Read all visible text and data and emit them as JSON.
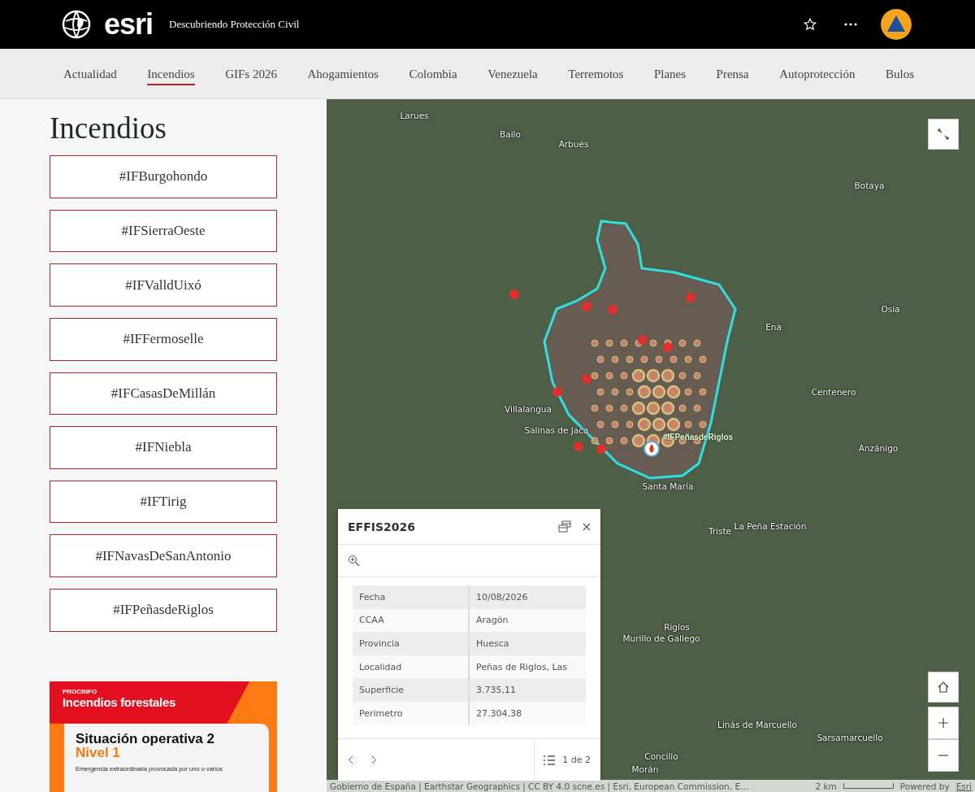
{
  "header": {
    "brand": "esri",
    "title": "Descubriendo Protección Civil"
  },
  "nav": [
    {
      "label": "Actualidad",
      "selected": false
    },
    {
      "label": "Incendios",
      "selected": true
    },
    {
      "label": "GIFs 2026",
      "selected": false
    },
    {
      "label": "Ahogamientos",
      "selected": false
    },
    {
      "label": "Colombia",
      "selected": false
    },
    {
      "label": "Venezuela",
      "selected": false
    },
    {
      "label": "Terremotos",
      "selected": false
    },
    {
      "label": "Planes",
      "selected": false
    },
    {
      "label": "Prensa",
      "selected": false
    },
    {
      "label": "Autoprotección",
      "selected": false
    },
    {
      "label": "Bulos",
      "selected": false
    }
  ],
  "sidebar": {
    "heading": "Incendios",
    "links": [
      "#IFBurgohondo",
      "#IFSierraOeste",
      "#IFValldUixó",
      "#IFFermoselle",
      "#IFCasasDeMillán",
      "#IFNiebla",
      "#IFTirig",
      "#IFNavasDeSanAntonio",
      "#IFPeñasdeRiglos"
    ],
    "banner": {
      "brand": "PROCINFO",
      "title": "Incendios forestales",
      "heading": "Situación operativa 2",
      "level": "Nivel 1",
      "text": "Emergencia extraordinaria provocada por uno o varios"
    }
  },
  "map": {
    "places": [
      "Larues",
      "Bailo",
      "Arbués",
      "Botaya",
      "Osia",
      "Ena",
      "Centenero",
      "Villalangua",
      "Salinas de Jaca",
      "Anzánigo",
      "Santa María",
      "La Peña Estación",
      "Triste",
      "Riglos",
      "Murillo de Gallego",
      "Linás de Marcuello",
      "Sarsamarcuello",
      "Concilio",
      "Morán"
    ],
    "fire_label": "#IFPeñasdeRiglos",
    "popup": {
      "title": "EFFIS2026",
      "fields": [
        {
          "label": "Fecha",
          "value": "10/08/2026"
        },
        {
          "label": "CCAA",
          "value": "Aragón"
        },
        {
          "label": "Provincia",
          "value": "Huesca"
        },
        {
          "label": "Localidad",
          "value": "Peñas de Riglos, Las"
        },
        {
          "label": "Superficie",
          "value": "3.735,11"
        },
        {
          "label": "Perimetro",
          "value": "27.304,38"
        }
      ],
      "pager": "1 de 2"
    },
    "attribution": "Gobierno de España | Earthstar Geographics | CC BY 4.0 scne.es | Esri, European Commission, E…",
    "scale": "2 km",
    "powered": "Powered by",
    "powered_link": "Esri"
  }
}
